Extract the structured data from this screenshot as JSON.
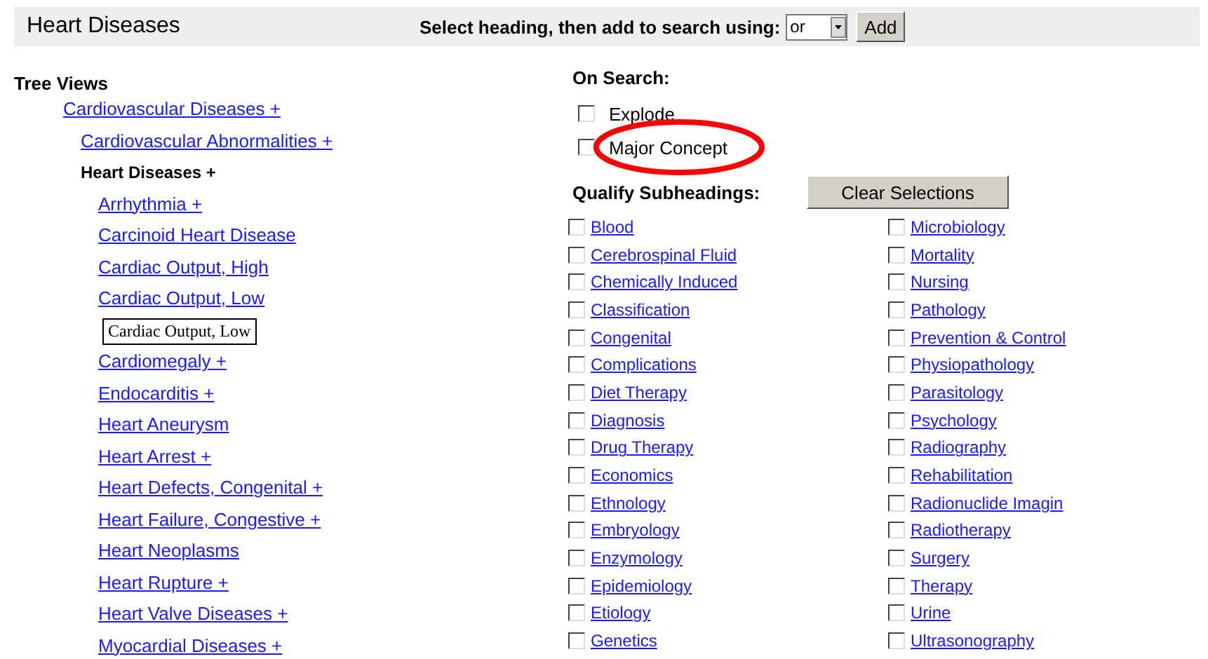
{
  "header": {
    "title": "Heart Diseases",
    "prompt": "Select heading, then add to search using:",
    "operator": "or",
    "add_button": "Add"
  },
  "tree": {
    "title": "Tree Views",
    "items": [
      {
        "text": "Cardiovascular Diseases +",
        "kind": "link",
        "children": [
          {
            "text": "Cardiovascular Abnormalities +",
            "kind": "link"
          },
          {
            "text": "Heart Diseases +",
            "kind": "current",
            "children": [
              {
                "text": "Arrhythmia +",
                "kind": "link"
              },
              {
                "text": "Carcinoid Heart Disease",
                "kind": "link"
              },
              {
                "text": "Cardiac Output, High",
                "kind": "link"
              },
              {
                "text": "Cardiac Output, Low",
                "kind": "link"
              },
              {
                "text": "Cardiac Output, Low",
                "kind": "tooltip"
              },
              {
                "text": "Cardiomegaly +",
                "kind": "link"
              },
              {
                "text": "Endocarditis +",
                "kind": "link"
              },
              {
                "text": "Heart Aneurysm",
                "kind": "link"
              },
              {
                "text": "Heart Arrest +",
                "kind": "link"
              },
              {
                "text": "Heart Defects, Congenital +",
                "kind": "link"
              },
              {
                "text": "Heart Failure, Congestive +",
                "kind": "link"
              },
              {
                "text": "Heart Neoplasms",
                "kind": "link"
              },
              {
                "text": "Heart Rupture +",
                "kind": "link"
              },
              {
                "text": "Heart Valve Diseases +",
                "kind": "link"
              },
              {
                "text": "Myocardial Diseases +",
                "kind": "link"
              }
            ]
          }
        ]
      }
    ]
  },
  "on_search": {
    "title": "On Search:",
    "options": [
      {
        "label": "Explode",
        "checked": false
      },
      {
        "label": "Major Concept",
        "checked": false
      }
    ]
  },
  "subheadings": {
    "title": "Qualify Subheadings:",
    "clear_button": "Clear Selections",
    "column_1": [
      {
        "label": "Blood",
        "checked": false
      },
      {
        "label": "Cerebrospinal Fluid",
        "checked": false
      },
      {
        "label": "Chemically Induced",
        "checked": false
      },
      {
        "label": "Classification",
        "checked": false
      },
      {
        "label": "Congenital",
        "checked": false
      },
      {
        "label": "Complications",
        "checked": false
      },
      {
        "label": "Diet Therapy",
        "checked": false
      },
      {
        "label": "Diagnosis",
        "checked": false
      },
      {
        "label": "Drug Therapy",
        "checked": false
      },
      {
        "label": "Economics",
        "checked": false
      },
      {
        "label": "Ethnology",
        "checked": false
      },
      {
        "label": "Embryology",
        "checked": false
      },
      {
        "label": "Enzymology",
        "checked": false
      },
      {
        "label": "Epidemiology",
        "checked": false
      },
      {
        "label": "Etiology",
        "checked": false
      },
      {
        "label": "Genetics",
        "checked": false
      }
    ],
    "column_2": [
      {
        "label": "Microbiology",
        "checked": false
      },
      {
        "label": "Mortality",
        "checked": false
      },
      {
        "label": "Nursing",
        "checked": false
      },
      {
        "label": "Pathology",
        "checked": false
      },
      {
        "label": "Prevention & Control",
        "checked": false
      },
      {
        "label": "Physiopathology",
        "checked": false
      },
      {
        "label": "Parasitology",
        "checked": false
      },
      {
        "label": "Psychology",
        "checked": false
      },
      {
        "label": "Radiography",
        "checked": false
      },
      {
        "label": "Rehabilitation",
        "checked": false
      },
      {
        "label": "Radionuclide Imagin",
        "checked": false
      },
      {
        "label": "Radiotherapy",
        "checked": false
      },
      {
        "label": "Surgery",
        "checked": false
      },
      {
        "label": "Therapy",
        "checked": false
      },
      {
        "label": "Urine",
        "checked": false
      },
      {
        "label": "Ultrasonography",
        "checked": false
      }
    ]
  }
}
